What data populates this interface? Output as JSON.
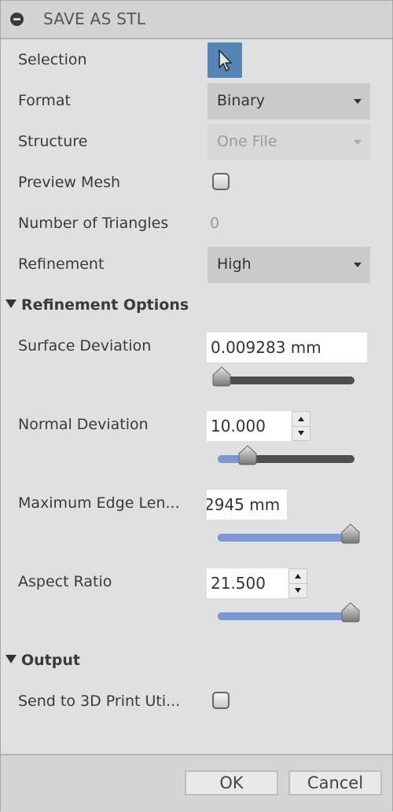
{
  "header": {
    "title": "SAVE AS STL",
    "icon": "collapse-minus-icon"
  },
  "fields": {
    "selection": {
      "label": "Selection",
      "icon": "select-arrow-icon",
      "color": "#5585b5"
    },
    "format": {
      "label": "Format",
      "value": "Binary"
    },
    "structure": {
      "label": "Structure",
      "value": "One File",
      "disabled": true
    },
    "preview_mesh": {
      "label": "Preview Mesh",
      "checked": false
    },
    "num_triangles": {
      "label": "Number of Triangles",
      "value": "0"
    },
    "refinement": {
      "label": "Refinement",
      "value": "High"
    }
  },
  "refinement_options": {
    "title": "Refinement Options",
    "surface_deviation": {
      "label": "Surface Deviation",
      "value": "0.009283 mm",
      "slider_fraction": 0.0
    },
    "normal_deviation": {
      "label": "Normal Deviation",
      "value": "10.000",
      "slider_fraction": 0.2
    },
    "max_edge_length": {
      "label": "Maximum Edge Len...",
      "value": "2945 mm",
      "slider_fraction": 1.0
    },
    "aspect_ratio": {
      "label": "Aspect Ratio",
      "value": "21.500",
      "slider_fraction": 1.0
    }
  },
  "output": {
    "title": "Output",
    "send_to_3d_print": {
      "label": "Send to 3D Print Uti...",
      "checked": false
    }
  },
  "footer": {
    "ok_label": "OK",
    "cancel_label": "Cancel"
  },
  "colors": {
    "slider_fill": "#7b98d2",
    "slider_track": "#4e4e4e"
  }
}
